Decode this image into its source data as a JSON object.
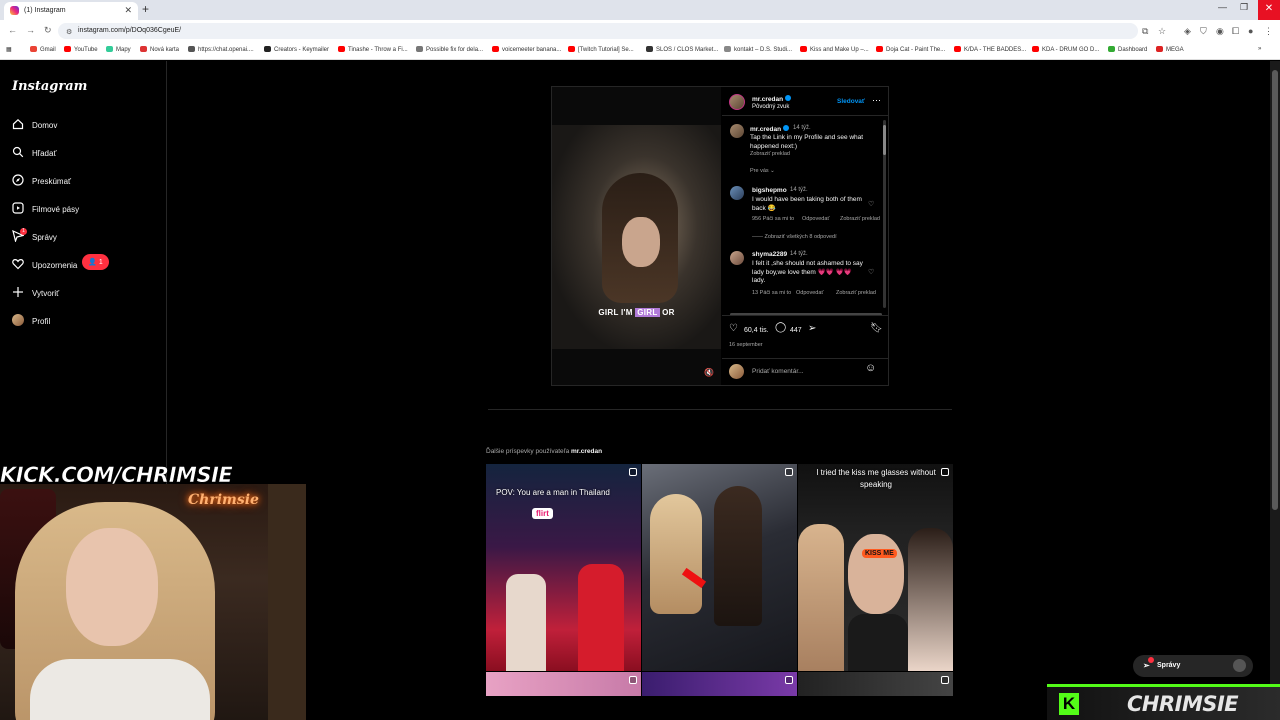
{
  "browser": {
    "tab_title": "(1) Instagram",
    "url": "instagram.com/p/DOq036CgeuE/",
    "bookmarks": [
      "Gmail",
      "YouTube",
      "Mapy",
      "Nová karta",
      "https://chat.openai....",
      "Creators - Keymailer",
      "Tinashe - Throw a Fi...",
      "Possible fix for dela...",
      "voicemeeter banana...",
      "[Twitch Tutorial] Se...",
      "SLOS / CLOS Market...",
      "kontakt – D.S. Studi...",
      "Kiss and Make Up –...",
      "Doja Cat - Paint The...",
      "K/DA - THE BADDES...",
      "KDA - DRUM GO D...",
      "Dashboard",
      "MEGA"
    ]
  },
  "sidebar": {
    "logo": "Instagram",
    "items": [
      "Domov",
      "Hľadať",
      "Preskúmať",
      "Filmové pásy",
      "Správy",
      "Upozornenia",
      "Vytvoriť",
      "Profil"
    ],
    "notif_count": "1",
    "msg_count": "1"
  },
  "post": {
    "author": "mr.credan",
    "audio": "Pôvodný zvuk",
    "follow": "Sledovať",
    "video_caption_pre": "GIRL I'M ",
    "video_caption_hl": "GIRL",
    "video_caption_post": " OR",
    "caption": {
      "user": "mr.credan",
      "age": "14 týž.",
      "text": "Tap the Link in my Profile and see what happened next:)",
      "translate": "Zobraziť preklad"
    },
    "for_you": "Pre vás",
    "comments": [
      {
        "user": "bigshepmo",
        "age": "14 týž.",
        "text": "I would have been taking both of them back 😂",
        "likes": "956 Páči sa mi to",
        "reply": "Odpovedať",
        "translate": "Zobraziť preklad",
        "replies": "Zobraziť všetkých 8 odpovedí"
      },
      {
        "user": "shyma2289",
        "age": "14 týž.",
        "text": "I felt it ,she should not ashamed to say lady boy,we love them 💗💗 💗💗 lady.",
        "likes": "13 Páči sa mi to",
        "reply": "Odpovedať",
        "translate": "Zobraziť preklad"
      }
    ],
    "like_count": "60,4 tis.",
    "comment_count": "447",
    "date": "16 september",
    "add_comment": "Pridať komentár..."
  },
  "more": {
    "title_prefix": "Ďalšie príspevky používateľa",
    "title_user": "mr.credan",
    "thumb1_caption": "POV: You are a man in Thailand",
    "thumb1_sign": "flirt",
    "thumb3_caption": "I tried the kiss me glasses without speaking",
    "thumb3_glasses": "KISS ME"
  },
  "overlay": {
    "kick_banner": "KICK.COM/CHRIMSIE",
    "neon_sign": "Chrimsie",
    "messages_popup": "Správy",
    "stream_name": "CHRIMSIE",
    "kick_logo": "K"
  }
}
